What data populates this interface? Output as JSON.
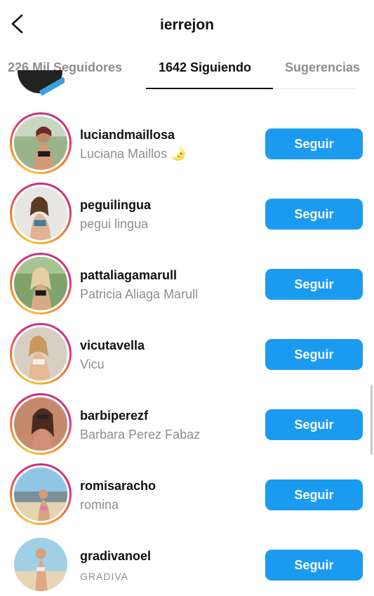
{
  "header": {
    "title": "ierrejon"
  },
  "tabs": [
    {
      "label": "226 Mil Seguidores",
      "active": false
    },
    {
      "label": "1642 Siguiendo",
      "active": true
    },
    {
      "label": "Sugerencias",
      "active": false
    }
  ],
  "accounts": [
    {
      "username": "luciandmaillosa",
      "fullname": "Luciana Maillos 🌛",
      "button": "Seguir",
      "story_ring": true
    },
    {
      "username": "peguilingua",
      "fullname": "pegui lingua",
      "button": "Seguir",
      "story_ring": true
    },
    {
      "username": "pattaliagamarull",
      "fullname": "Patricia Aliaga Marull",
      "button": "Seguir",
      "story_ring": true
    },
    {
      "username": "vicutavella",
      "fullname": "Vicu",
      "button": "Seguir",
      "story_ring": true
    },
    {
      "username": "barbiperezf",
      "fullname": "Barbara Perez Fabaz",
      "button": "Seguir",
      "story_ring": true
    },
    {
      "username": "romisaracho",
      "fullname": "romina",
      "button": "Seguir",
      "story_ring": true
    },
    {
      "username": "gradivanoel",
      "fullname": "GRADIVA",
      "button": "Seguir",
      "story_ring": false
    }
  ],
  "colors": {
    "accent": "#1a9bf0",
    "muted_text": "#8e8e8e"
  },
  "icons": {
    "back": "chevron-left-icon"
  }
}
